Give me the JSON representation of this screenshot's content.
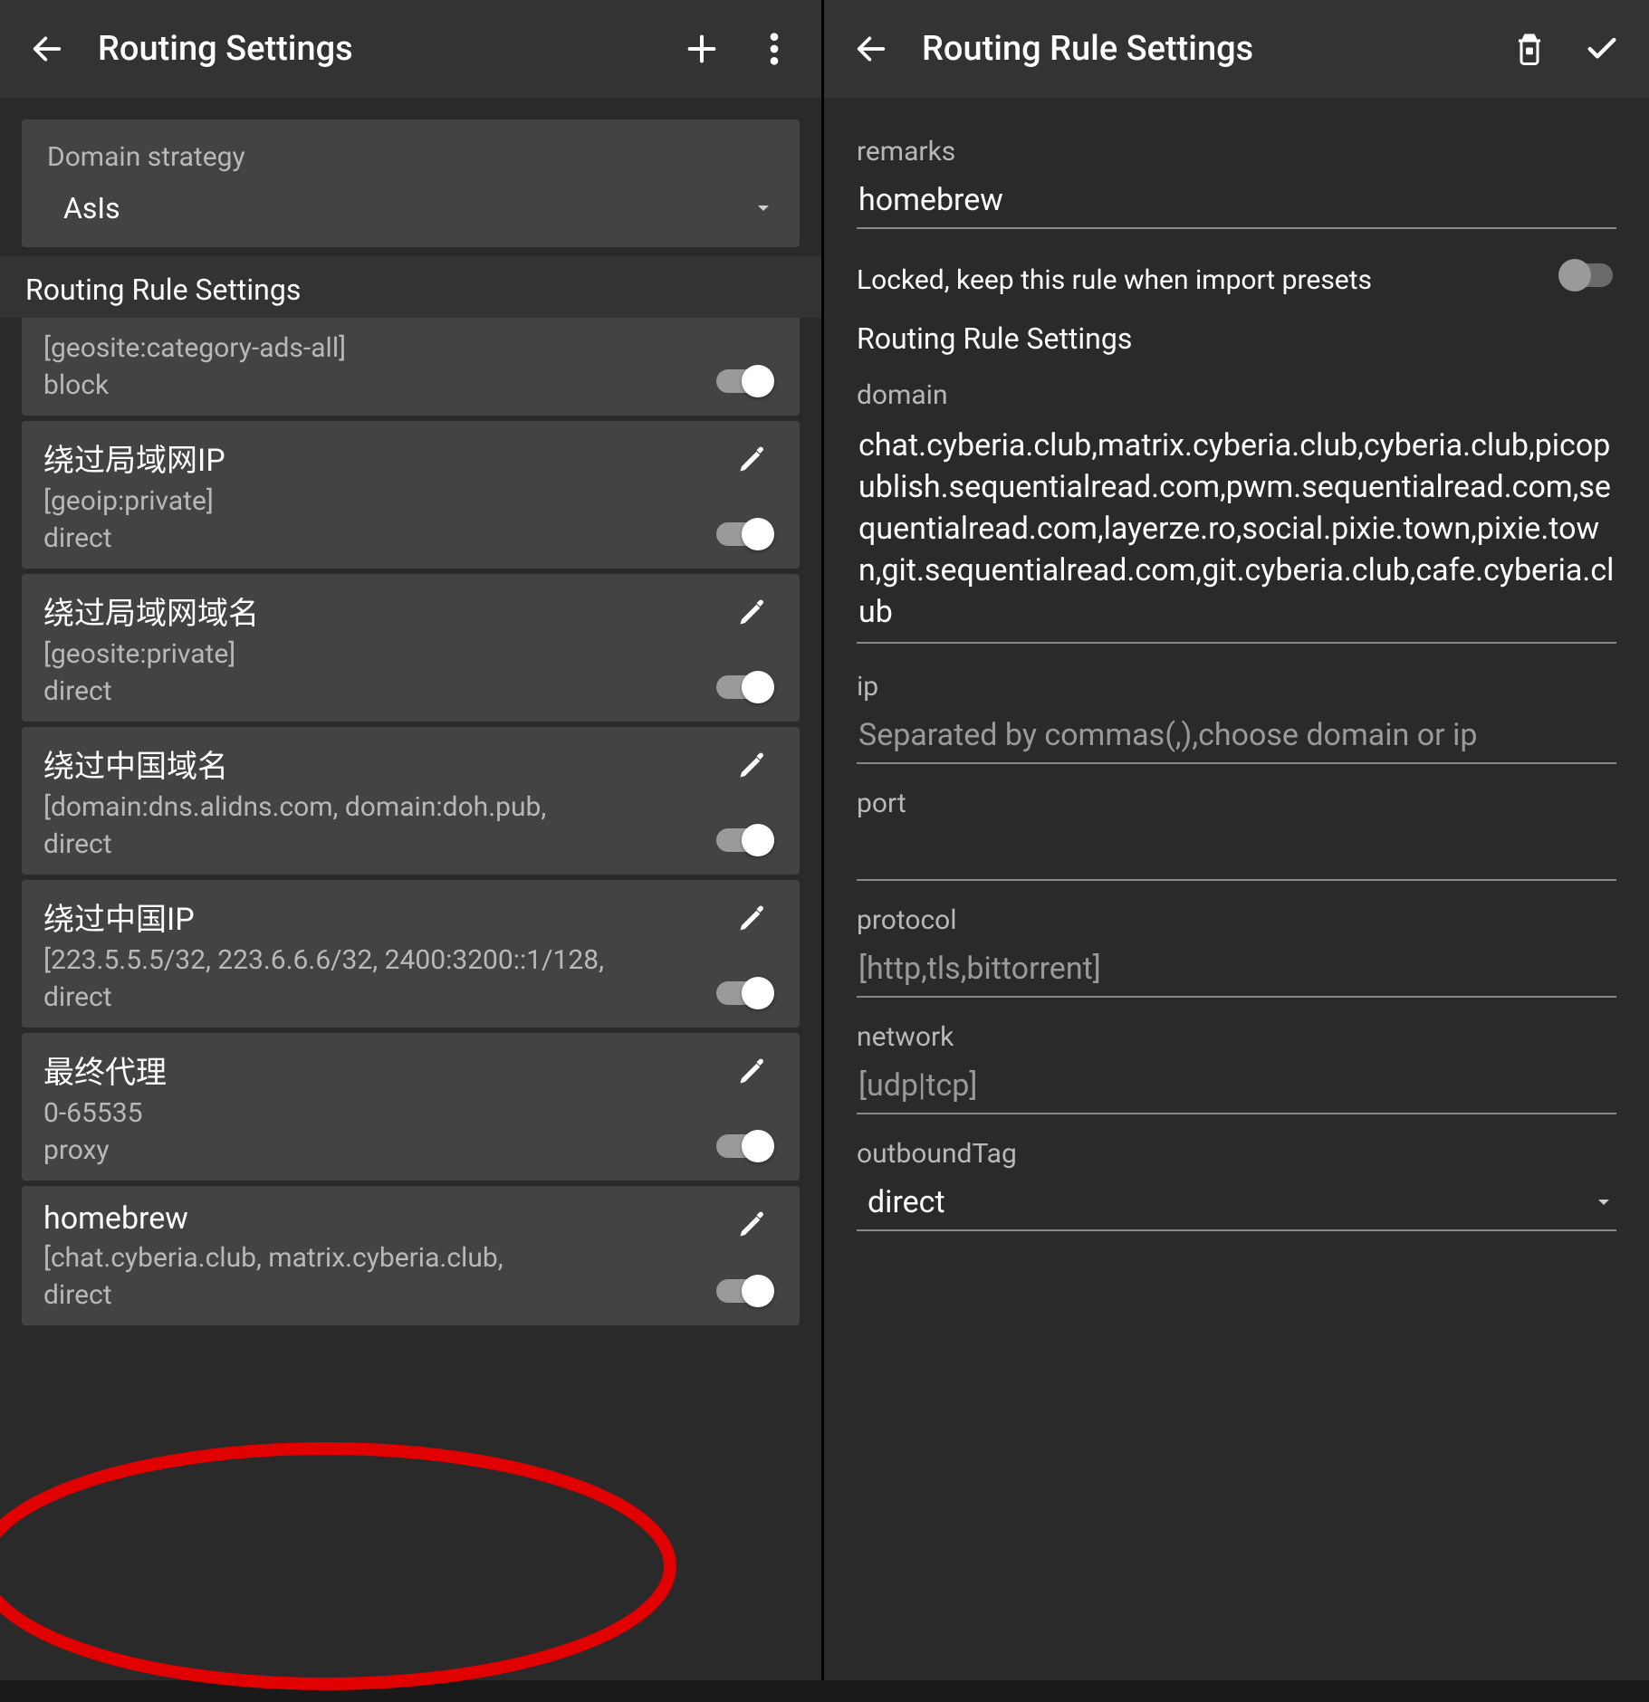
{
  "left": {
    "title": "Routing Settings",
    "strategy_label": "Domain strategy",
    "strategy_value": "AsIs",
    "rules_header": "Routing Rule Settings",
    "rules": [
      {
        "title": "",
        "sub": "[geosite:category-ads-all]",
        "action": "block",
        "hasEdit": false
      },
      {
        "title": "绕过局域网IP",
        "sub": "[geoip:private]",
        "action": "direct",
        "hasEdit": true
      },
      {
        "title": "绕过局域网域名",
        "sub": "[geosite:private]",
        "action": "direct",
        "hasEdit": true
      },
      {
        "title": "绕过中国域名",
        "sub": "[domain:dns.alidns.com, domain:doh.pub,",
        "action": "direct",
        "hasEdit": true
      },
      {
        "title": "绕过中国IP",
        "sub": "[223.5.5.5/32, 223.6.6.6/32, 2400:3200::1/128,",
        "action": "direct",
        "hasEdit": true
      },
      {
        "title": "最终代理",
        "sub": "0-65535",
        "action": "proxy",
        "hasEdit": true
      },
      {
        "title": "homebrew",
        "sub": "[chat.cyberia.club, matrix.cyberia.club,",
        "action": "direct",
        "hasEdit": true
      }
    ]
  },
  "right": {
    "title": "Routing Rule Settings",
    "remarks_label": "remarks",
    "remarks_value": "homebrew",
    "locked_label": "Locked, keep this rule when import presets",
    "section": "Routing Rule Settings",
    "domain_label": "domain",
    "domain_value": "chat.cyberia.club,matrix.cyberia.club,cyberia.club,picopublish.sequentialread.com,pwm.sequentialread.com,sequentialread.com,layerze.ro,social.pixie.town,pixie.town,git.sequentialread.com,git.cyberia.club,cafe.cyberia.club",
    "ip_label": "ip",
    "ip_placeholder": "Separated by commas(,),choose domain or ip",
    "port_label": "port",
    "protocol_label": "protocol",
    "protocol_placeholder": "[http,tls,bittorrent]",
    "network_label": "network",
    "network_placeholder": "[udp|tcp]",
    "outbound_label": "outboundTag",
    "outbound_value": "direct"
  }
}
